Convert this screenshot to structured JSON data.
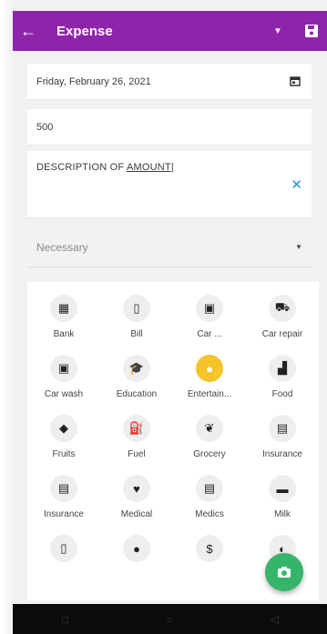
{
  "appbar": {
    "title": "Expense",
    "back_icon": "back-arrow-icon",
    "dropdown_icon": "dropdown-arrow-icon",
    "save_icon": "save-icon",
    "color": "#8e24aa"
  },
  "form": {
    "date": "Friday, February 26, 2021",
    "amount": "500",
    "description_prefix": "DESCRIPTION OF ",
    "description_underlined": "AMOUNT",
    "clear_icon": "✕",
    "category_type_placeholder": "Necessary",
    "select_arrow": "▼"
  },
  "categories": [
    {
      "label": "Bank",
      "glyph": "▦",
      "icon": "bank-icon"
    },
    {
      "label": "Bill",
      "glyph": "▯",
      "icon": "phone-icon"
    },
    {
      "label": "Car ...",
      "glyph": "▣",
      "icon": "car-icon"
    },
    {
      "label": "Car repair",
      "glyph": "⛟",
      "icon": "car-repair-icon"
    },
    {
      "label": "Car wash",
      "glyph": "▣",
      "icon": "car-wash-icon"
    },
    {
      "label": "Education",
      "glyph": "🎓",
      "icon": "education-icon"
    },
    {
      "label": "Entertain...",
      "glyph": "●",
      "icon": "entertainment-icon",
      "active": true
    },
    {
      "label": "Food",
      "glyph": "▟",
      "icon": "food-icon"
    },
    {
      "label": "Fruits",
      "glyph": "◆",
      "icon": "fruits-icon"
    },
    {
      "label": "Fuel",
      "glyph": "⛽",
      "icon": "fuel-icon"
    },
    {
      "label": "Grocery",
      "glyph": "❦",
      "icon": "grocery-icon"
    },
    {
      "label": "Insurance",
      "glyph": "▤",
      "icon": "insurance-icon"
    },
    {
      "label": "Insurance",
      "glyph": "▤",
      "icon": "insurance-icon"
    },
    {
      "label": "Medical",
      "glyph": "♥",
      "icon": "medical-icon"
    },
    {
      "label": "Medics",
      "glyph": "▤",
      "icon": "medics-icon"
    },
    {
      "label": "Milk",
      "glyph": "▬",
      "icon": "milk-icon"
    },
    {
      "label": "",
      "glyph": "▯",
      "icon": "phone-icon"
    },
    {
      "label": "",
      "glyph": "●",
      "icon": "rating-icon"
    },
    {
      "label": "",
      "glyph": "$",
      "icon": "dollar-icon"
    },
    {
      "label": "",
      "glyph": "◐",
      "icon": "misc-icon"
    }
  ],
  "fab": {
    "icon": "camera-icon",
    "color": "#35b46a"
  },
  "navbar": {
    "square": "□",
    "circle": "○",
    "back": "◁"
  }
}
